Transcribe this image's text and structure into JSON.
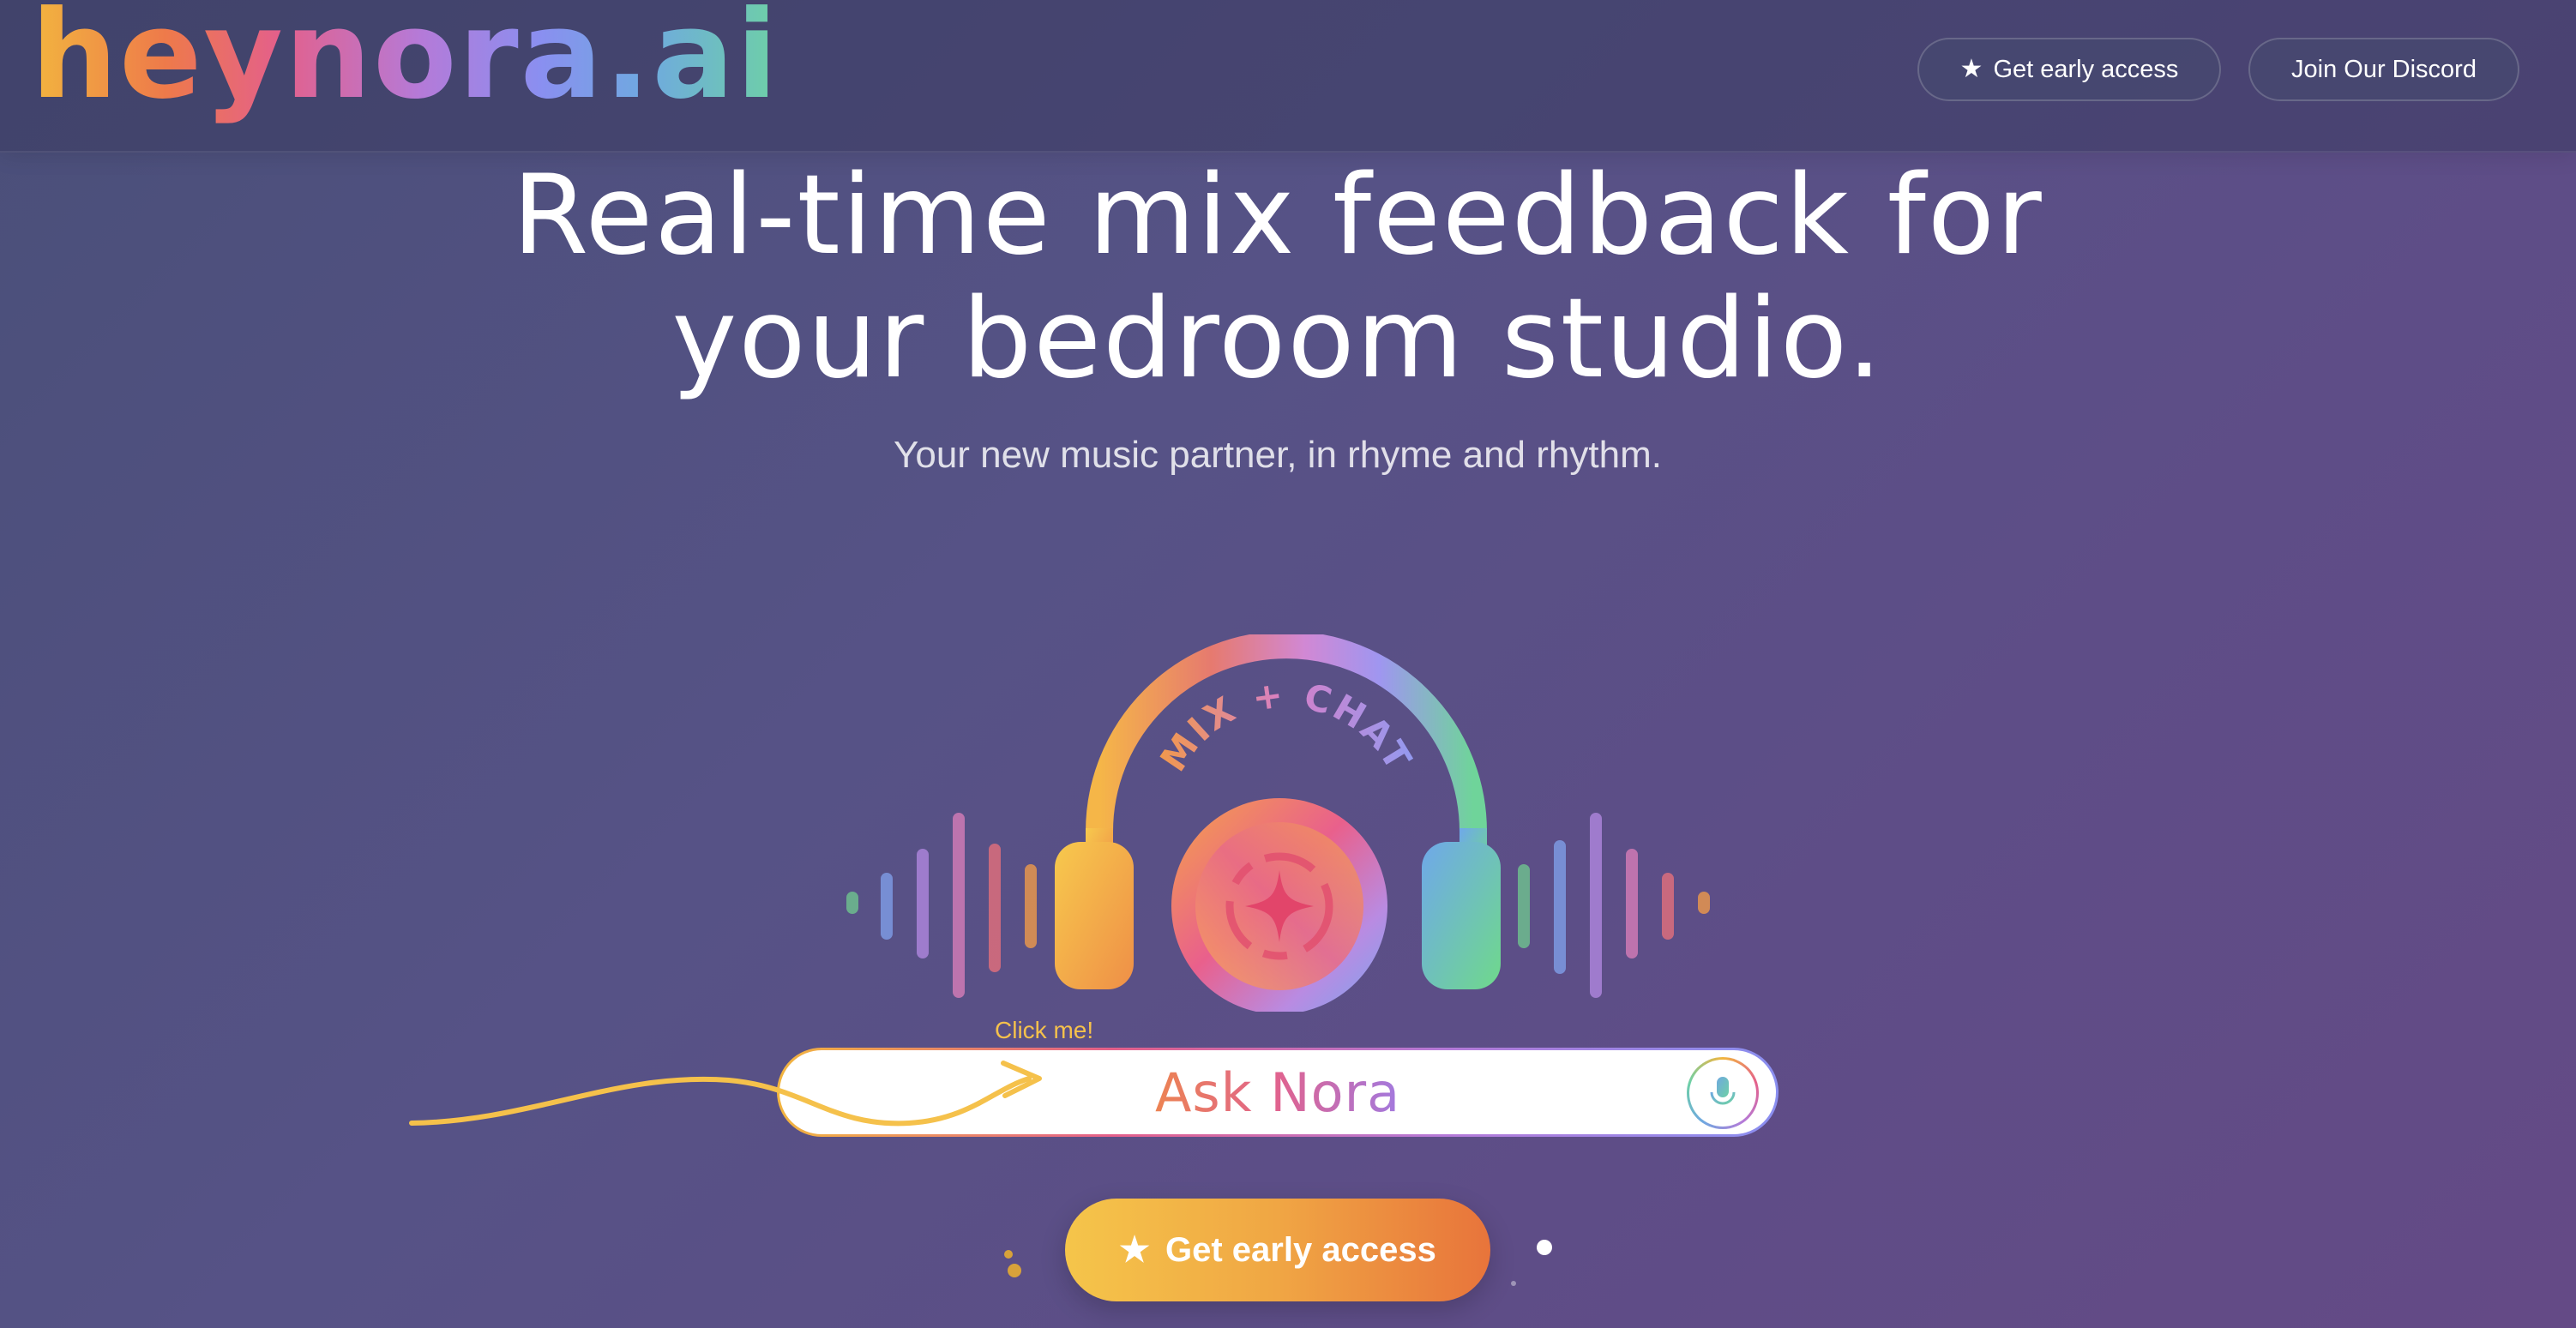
{
  "header": {
    "logo_text": "heynora.ai",
    "early_access_label": "Get early access",
    "discord_label": "Join Our Discord",
    "star_icon": "★"
  },
  "hero": {
    "title_line1": "Real-time mix feedback for",
    "title_line2": "your bedroom studio.",
    "subtitle": "Your new music partner, in rhyme and rhythm."
  },
  "illustration": {
    "badge_text": "MIX + CHAT"
  },
  "ask": {
    "hint": "Click me!",
    "label": "Ask Nora"
  },
  "cta": {
    "label": "Get early access",
    "star_icon": "★"
  },
  "colors": {
    "brand_yellow": "#f2b53f",
    "brand_orange": "#ee7a4a",
    "brand_pink": "#e4608a",
    "brand_purple": "#b57ad8",
    "brand_blue": "#8a8ff0",
    "brand_green": "#6ed0a6"
  }
}
